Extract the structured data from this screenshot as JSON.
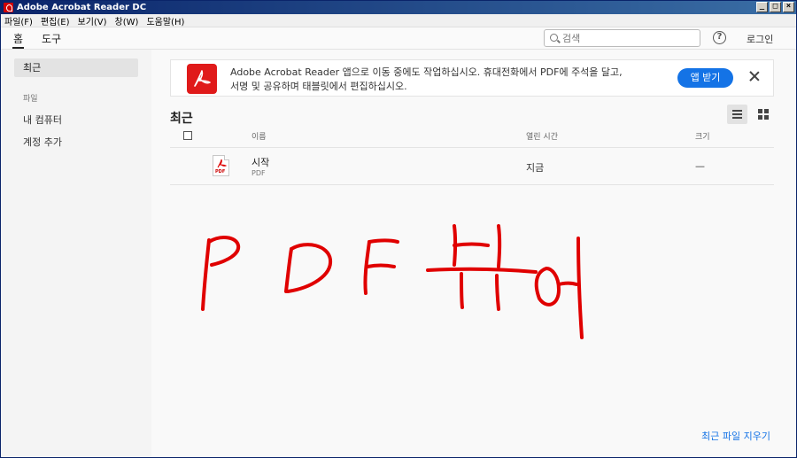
{
  "window": {
    "title": "Adobe Acrobat Reader DC",
    "controls": [
      "_",
      "□",
      "×"
    ]
  },
  "menubar": {
    "items": [
      "파일(F)",
      "편집(E)",
      "보기(V)",
      "창(W)",
      "도움말(H)"
    ]
  },
  "topnav": {
    "tabs": [
      "홈",
      "도구"
    ],
    "search_placeholder": "검색",
    "help": "?",
    "login": "로그인"
  },
  "sidebar": {
    "recent": "최근",
    "files_heading": "파일",
    "my_computer": "내 컴퓨터",
    "add_account": "계정 추가"
  },
  "banner": {
    "line1": "Adobe Acrobat Reader 앱으로 이동 중에도 작업하십시오. 휴대전화에서 PDF에 주석을 달고,",
    "line2": "서명 및 공유하며 태블릿에서 편집하십시오.",
    "button": "앱 받기"
  },
  "recent": {
    "title": "최근",
    "columns": {
      "name": "이름",
      "opened": "열린 시간",
      "size": "크기"
    },
    "files": [
      {
        "name": "시작",
        "type": "PDF",
        "opened": "지금",
        "size": "—"
      }
    ],
    "clear_link": "최근 파일 지우기"
  },
  "colors": {
    "accent": "#1473e6",
    "acrobat_red": "#e01a1a",
    "scribble": "#e00000"
  },
  "icons": [
    "search-icon",
    "help-icon",
    "acrobat-logo-icon",
    "close-icon",
    "list-view-icon",
    "grid-view-icon",
    "pdf-file-icon"
  ]
}
